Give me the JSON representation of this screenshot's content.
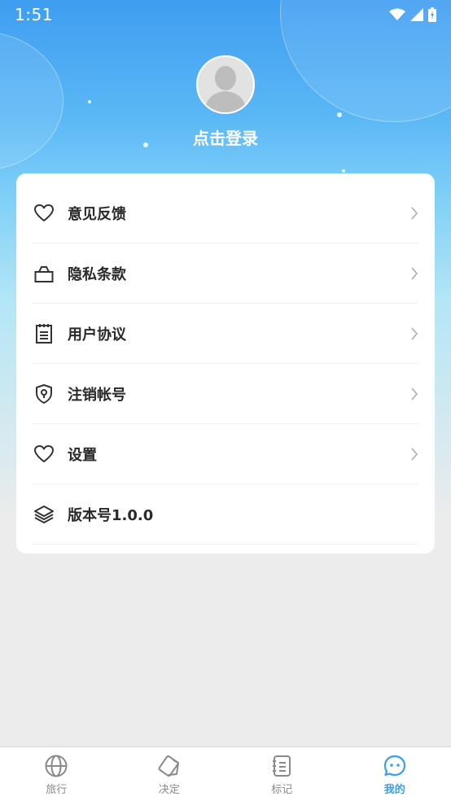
{
  "status_bar": {
    "time": "1:51"
  },
  "profile": {
    "login_label": "点击登录"
  },
  "menu": {
    "items": [
      {
        "label": "意见反馈",
        "icon": "heart-icon",
        "has_arrow": true
      },
      {
        "label": "隐私条款",
        "icon": "lock-icon",
        "has_arrow": true
      },
      {
        "label": "用户协议",
        "icon": "clipboard-icon",
        "has_arrow": true
      },
      {
        "label": "注销帐号",
        "icon": "shield-icon",
        "has_arrow": true
      },
      {
        "label": "设置",
        "icon": "heart-icon",
        "has_arrow": true
      },
      {
        "label": "版本号1.0.0",
        "icon": "layers-icon",
        "has_arrow": false
      }
    ]
  },
  "tabbar": {
    "tabs": [
      {
        "label": "旅行",
        "icon": "globe-icon",
        "active": false
      },
      {
        "label": "决定",
        "icon": "cards-icon",
        "active": false
      },
      {
        "label": "标记",
        "icon": "notebook-icon",
        "active": false
      },
      {
        "label": "我的",
        "icon": "chat-face-icon",
        "active": true
      }
    ]
  },
  "colors": {
    "accent": "#3a9ef0",
    "header_top": "#3f9df1",
    "background": "#ececec",
    "tab_inactive": "#8a8a8a"
  }
}
